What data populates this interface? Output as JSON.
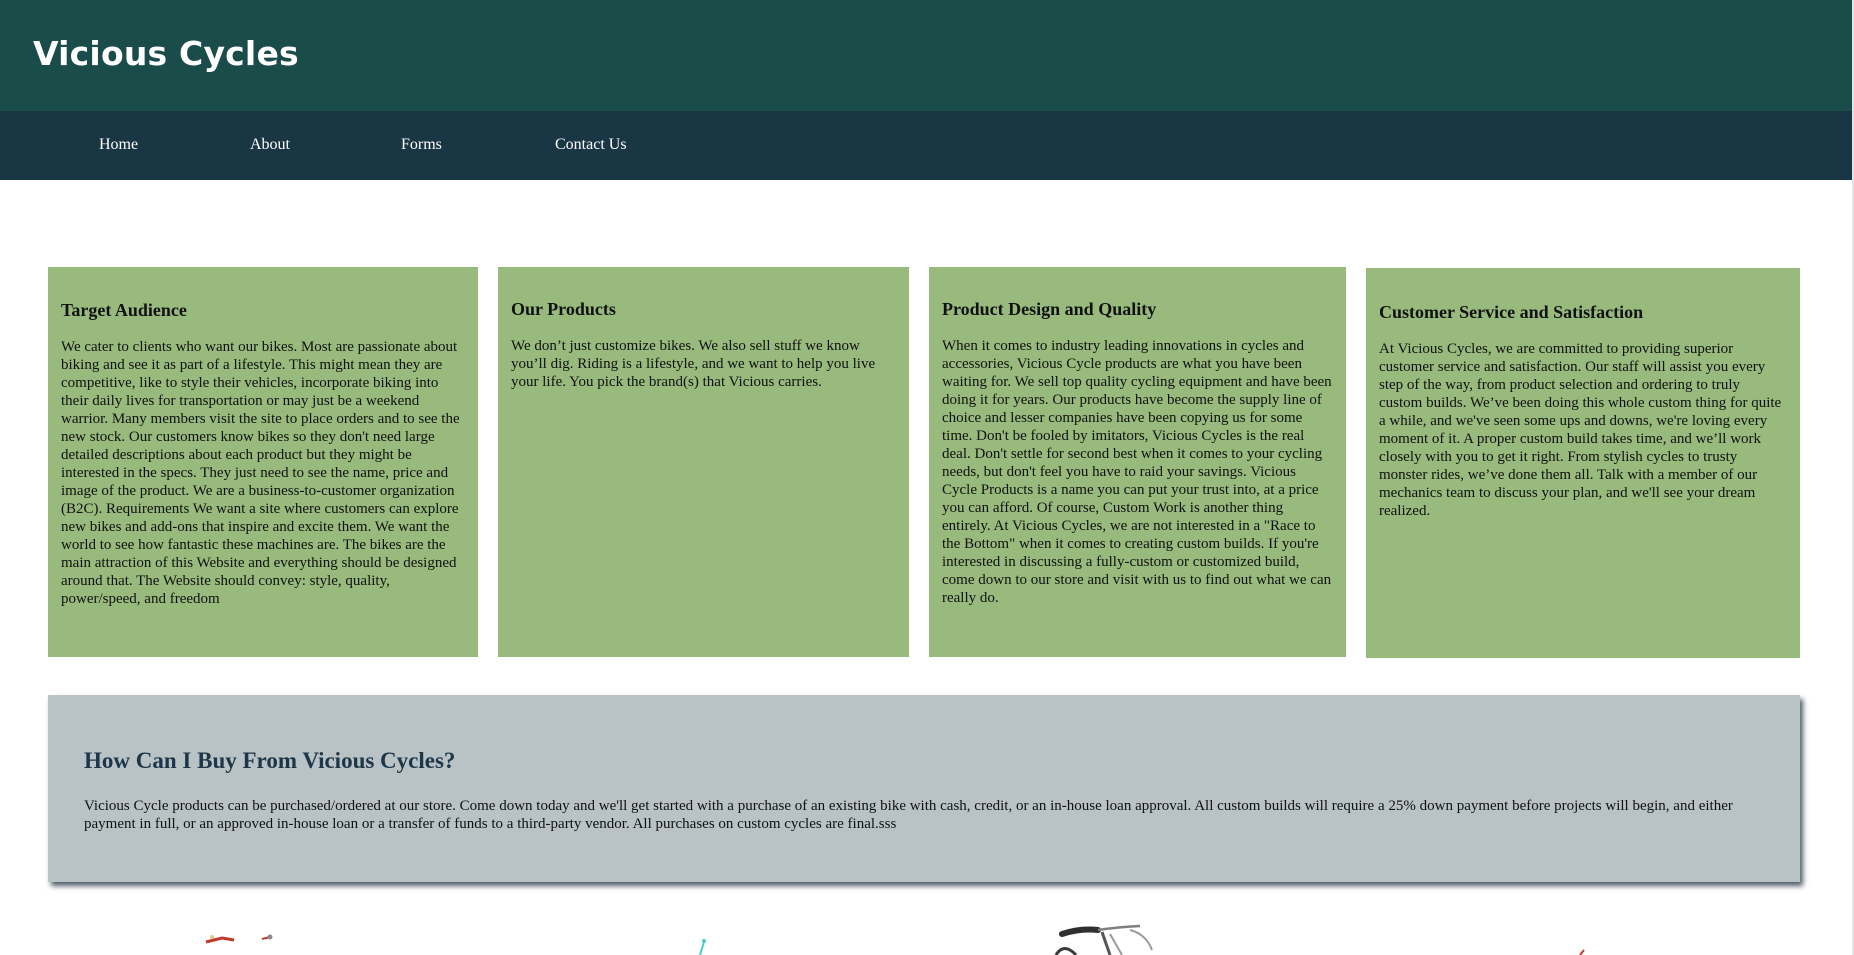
{
  "site": {
    "title": "Vicious Cycles"
  },
  "nav": {
    "items": [
      {
        "label": "Home"
      },
      {
        "label": "About"
      },
      {
        "label": "Forms"
      },
      {
        "label": "Contact Us"
      }
    ]
  },
  "cards": [
    {
      "heading": "Target Audience",
      "body": "We cater to clients who want our bikes. Most are passionate about biking and see it as part of a lifestyle. This might mean they are competitive, like to style their vehicles, incorporate biking into their daily lives for transportation or may just be a weekend warrior. Many members visit the site to place orders and to see the new stock. Our customers know bikes so they don't need large detailed descriptions about each product but they might be interested in the specs. They just need to see the name, price and image of the product. We are a business-to-customer organization (B2C). Requirements We want a site where customers can explore new bikes and add-ons that inspire and excite them. We want the world to see how fantastic these machines are. The bikes are the main attraction of this Website and everything should be designed around that. The Website should convey: style, quality, power/speed, and freedom"
    },
    {
      "heading": "Our Products",
      "body": "We don’t just customize bikes. We also sell stuff we know you’ll dig. Riding is a lifestyle, and we want to help you live your life. You pick the brand(s) that Vicious carries."
    },
    {
      "heading": "Product Design and Quality",
      "body": "When it comes to industry leading innovations in cycles and accessories, Vicious Cycle products are what you have been waiting for. We sell top quality cycling equipment and have been doing it for years. Our products have become the supply line of choice and lesser companies have been copying us for some time. Don't be fooled by imitators, Vicious Cycles is the real deal. Don't settle for second best when it comes to your cycling needs, but don't feel you have to raid your savings. Vicious Cycle Products is a name you can put your trust into, at a price you can afford. Of course, Custom Work is another thing entirely. At Vicious Cycles, we are not interested in a \"Race to the Bottom\" when it comes to creating custom builds. If you're interested in discussing a fully-custom or customized build, come down to our store and visit with us to find out what we can really do."
    },
    {
      "heading": "Customer Service and Satisfaction",
      "body": "At Vicious Cycles, we are committed to providing superior customer service and satisfaction. Our staff will assist you every step of the way, from product selection and ordering to truly custom builds. We’ve been doing this whole custom thing for quite a while, and we've seen some ups and downs, we're loving every moment of it. A proper custom build takes time, and we’ll work closely with you to get it right. From stylish cycles to trusty monster rides, we’ve done them all. Talk with a member of our mechanics team to discuss your plan, and we'll see your dream realized."
    }
  ],
  "buy": {
    "heading": "How Can I Buy From Vicious Cycles?",
    "body": "Vicious Cycle products can be purchased/ordered at our store. Come down today and we'll get started with a purchase of an existing bike with cash, credit, or an in-house loan approval. All custom builds will require a 25% down payment before projects will begin, and either payment in full, or an approved in-house loan or a transfer of funds to a third-party vendor. All purchases on custom cycles are final.sss"
  },
  "colors": {
    "header_bg": "#1a4d4a",
    "nav_bg": "#193645",
    "card_bg": "#98ba7d",
    "buy_panel_bg": "#b9c3c6",
    "buy_heading": "#1d3648"
  },
  "products_row": {
    "images": [
      {
        "icon": "red-bike-image"
      },
      {
        "icon": "teal-bike-image"
      },
      {
        "icon": "gray-bike-handlebar-image"
      },
      {
        "icon": "red-bike-image"
      }
    ]
  }
}
